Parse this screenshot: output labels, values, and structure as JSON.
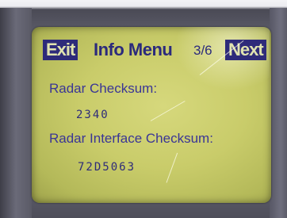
{
  "header": {
    "exit_label": "Exit",
    "title": "Info Menu",
    "page_indicator": "3/6",
    "next_label": "Next"
  },
  "info_rows": [
    {
      "label": "Radar Checksum:",
      "value": "2340"
    },
    {
      "label": "Radar Interface Checksum:",
      "value": "72D5063"
    }
  ],
  "colors": {
    "lcd_background": "#c9cc6a",
    "text_blue": "#2e2b7a",
    "button_fill": "#2e2b7a",
    "bezel": "#5b5b68"
  }
}
